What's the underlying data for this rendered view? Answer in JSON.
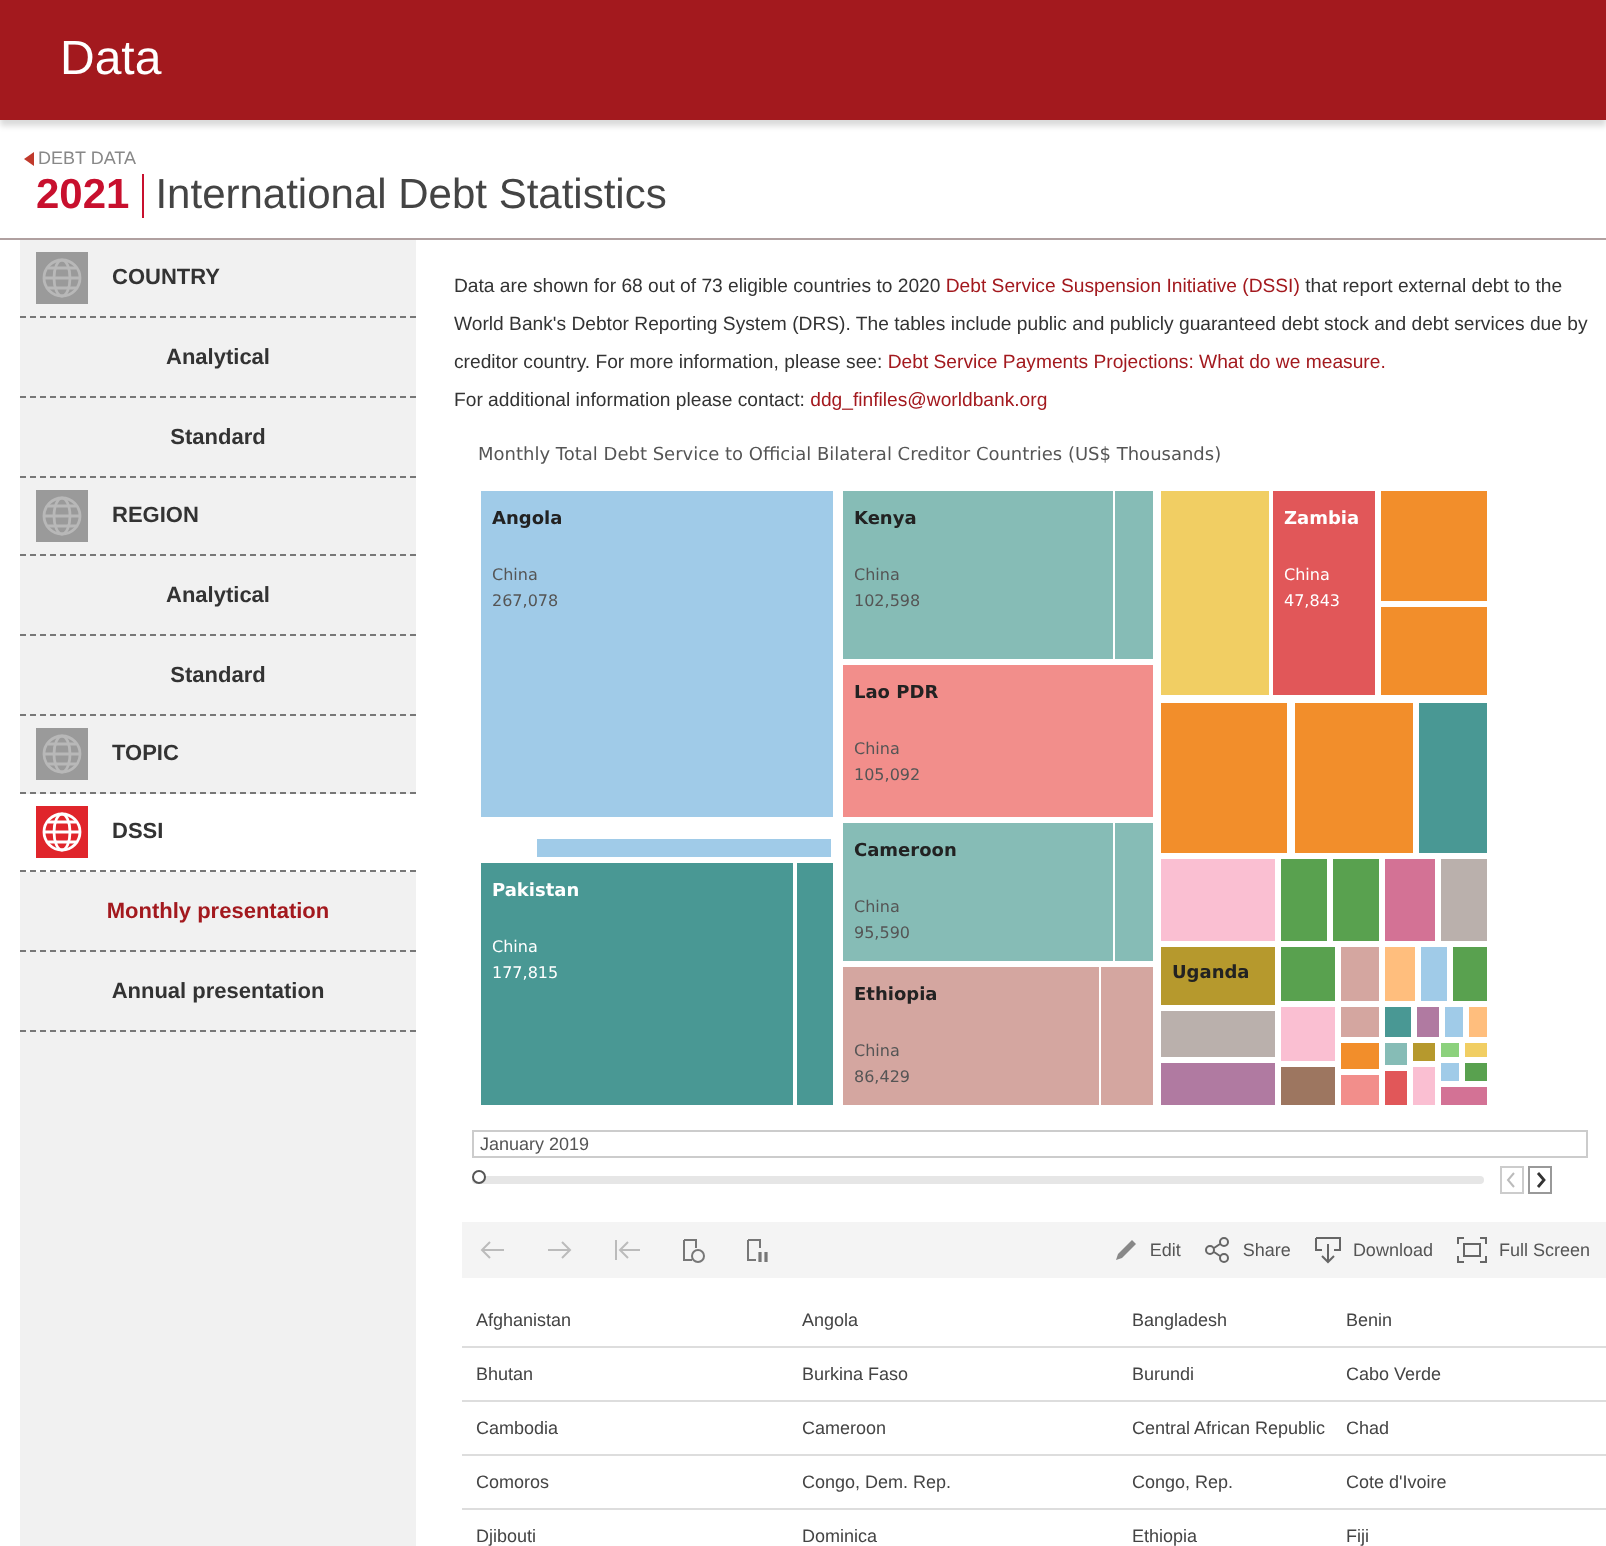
{
  "header": {
    "title": "Data"
  },
  "breadcrumb": {
    "label": "DEBT DATA"
  },
  "page_title": {
    "year": "2021",
    "name": "International Debt Statistics"
  },
  "sidebar": [
    {
      "label": "COUNTRY",
      "selected": false,
      "children": [
        {
          "label": "Analytical",
          "selected": false
        },
        {
          "label": "Standard",
          "selected": false
        }
      ]
    },
    {
      "label": "REGION",
      "selected": false,
      "children": [
        {
          "label": "Analytical",
          "selected": false
        },
        {
          "label": "Standard",
          "selected": false
        }
      ]
    },
    {
      "label": "TOPIC",
      "selected": false
    },
    {
      "label": "DSSI",
      "selected": true,
      "children": [
        {
          "label": "Monthly presentation",
          "selected": true
        },
        {
          "label": "Annual presentation",
          "selected": false
        }
      ]
    }
  ],
  "intro": {
    "parts": [
      {
        "kind": "text",
        "text": "Data are shown for 68 out of 73 eligible countries to 2020 "
      },
      {
        "kind": "link",
        "text": "Debt Service Suspension Initiative (DSSI)"
      },
      {
        "kind": "text",
        "text": " that report external debt to the World Bank's Debtor Reporting System (DRS). The tables include public and publicly guaranteed debt stock and debt services due by creditor country. For more information, please see: "
      },
      {
        "kind": "link",
        "text": "Debt Service Payments Projections: What do we measure."
      },
      {
        "kind": "break"
      },
      {
        "kind": "text",
        "text": "For additional information please contact: "
      },
      {
        "kind": "link",
        "text": "ddg_finfiles@worldbank.org"
      }
    ]
  },
  "treemap": {
    "title": "Monthly Total Debt Service to Official Bilateral Creditor Countries (US$ Thousands)",
    "tiles": [
      {
        "country": "Angola",
        "creditor": "China",
        "value": "267,078",
        "color": "#a0cbe8"
      },
      {
        "country": "Pakistan",
        "creditor": "China",
        "value": "177,815",
        "color": "#499894"
      },
      {
        "country": "Kenya",
        "creditor": "China",
        "value": "102,598",
        "color": "#86bcb6"
      },
      {
        "country": "Lao PDR",
        "creditor": "China",
        "value": "105,092",
        "color": "#f28e8b"
      },
      {
        "country": "Cameroon",
        "creditor": "China",
        "value": "95,590",
        "color": "#86bcb6"
      },
      {
        "country": "Ethiopia",
        "creditor": "China",
        "value": "86,429",
        "color": "#d4a6a0"
      },
      {
        "country": "Zambia",
        "creditor": "China",
        "value": "47,843",
        "color": "#e15759"
      },
      {
        "country": "Uganda",
        "color": "#b6992d"
      }
    ]
  },
  "slider": {
    "value": "January 2019",
    "level": 0
  },
  "toolbar": {
    "actions": [
      {
        "kind": "edit",
        "label": "Edit"
      },
      {
        "kind": "share",
        "label": "Share"
      },
      {
        "kind": "download",
        "label": "Download"
      },
      {
        "kind": "fullscreen",
        "label": "Full Screen"
      }
    ]
  },
  "countries": [
    [
      "Afghanistan",
      "Angola",
      "Bangladesh",
      "Benin"
    ],
    [
      "Bhutan",
      "Burkina Faso",
      "Burundi",
      "Cabo Verde"
    ],
    [
      "Cambodia",
      "Cameroon",
      "Central African Republic",
      "Chad"
    ],
    [
      "Comoros",
      "Congo, Dem. Rep.",
      "Congo, Rep.",
      "Cote d'Ivoire"
    ],
    [
      "Djibouti",
      "Dominica",
      "Ethiopia",
      "Fiji"
    ]
  ]
}
